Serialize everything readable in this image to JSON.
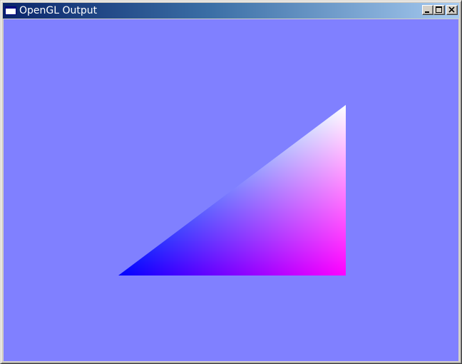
{
  "window": {
    "title": "OpenGL Output",
    "clear_color": "#8080ff"
  },
  "controls": {
    "minimize": "minimize-icon",
    "maximize": "maximize-icon",
    "close": "close-icon"
  },
  "triangle": {
    "vertex_colors": {
      "bottom_left": "#0000ff",
      "bottom_right": "#ff0000",
      "top_right": "#00ff00"
    }
  }
}
